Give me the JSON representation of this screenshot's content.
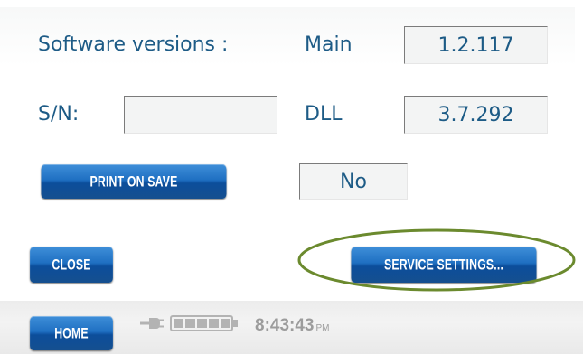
{
  "software": {
    "label": "Software versions :",
    "main_label": "Main",
    "main_version": "1.2.117",
    "dll_label": "DLL",
    "dll_version": "3.7.292"
  },
  "serial": {
    "label": "S/N:",
    "value": ""
  },
  "print_on_save": {
    "button_label": "PRINT ON SAVE",
    "value": "No"
  },
  "buttons": {
    "close": "CLOSE",
    "service_settings": "SERVICE SETTINGS...",
    "home": "HOME"
  },
  "status": {
    "power_icon": "plug-icon",
    "battery_icon": "battery-icon",
    "battery_level": 1.0,
    "time": "8:43:43",
    "ampm": "PM"
  },
  "colors": {
    "label_text": "#1d5b86",
    "button_blue": "#1f70c2",
    "highlight_ellipse": "#6b8a2e",
    "clock_text": "#9c9c9c"
  }
}
